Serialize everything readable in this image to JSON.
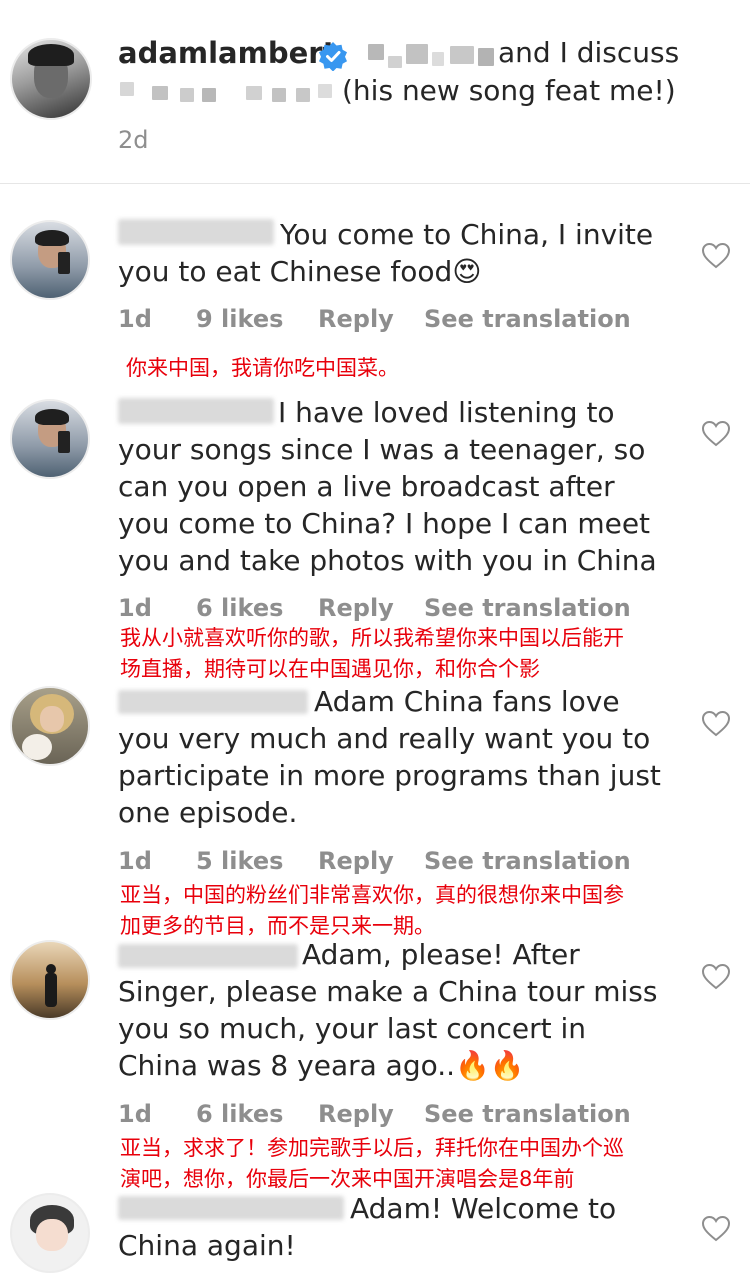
{
  "post": {
    "username": "adamlambert",
    "verified_icon": "verified-badge-icon",
    "caption_line1_tail": "and I discuss",
    "caption_line2_tail": "(his new song feat me!)",
    "timestamp": "2d"
  },
  "comments": [
    {
      "text": "You come to China, I invite\nyou to eat Chinese food😍",
      "time": "1d",
      "likes": "9 likes",
      "reply": "Reply",
      "see_translation": "See translation",
      "translation": "你来中国，我请你吃中国菜。"
    },
    {
      "text": "I have loved listening to\nyour songs since I was a teenager, so\ncan you open a live broadcast after\nyou come to China? I hope I can meet\nyou and take photos with you in China",
      "time": "1d",
      "likes": "6 likes",
      "reply": "Reply",
      "see_translation": "See translation",
      "translation": "我从小就喜欢听你的歌，所以我希望你来中国以后能开\n场直播，期待可以在中国遇见你，和你合个影"
    },
    {
      "text": "Adam China fans love\nyou very much and really want you to\nparticipate in more programs than just\none episode.",
      "time": "1d",
      "likes": "5 likes",
      "reply": "Reply",
      "see_translation": "See translation",
      "translation": "亚当，中国的粉丝们非常喜欢你，真的很想你来中国参\n加更多的节目，而不是只来一期。"
    },
    {
      "text": "Adam, please! After\nSinger, please make a China tour miss\nyou so much, your last concert in\nChina was 8 yeara ago..🔥🔥",
      "time": "1d",
      "likes": "6 likes",
      "reply": "Reply",
      "see_translation": "See translation",
      "translation": "亚当，求求了！参加完歌手以后，拜托你在中国办个巡\n演吧，想你，你最后一次来中国开演唱会是8年前"
    },
    {
      "text": "Adam! Welcome to\nChina again!"
    }
  ],
  "colors": {
    "meta": "#8e8e8e",
    "translation": "#e8000b",
    "verified": "#3897f0"
  }
}
